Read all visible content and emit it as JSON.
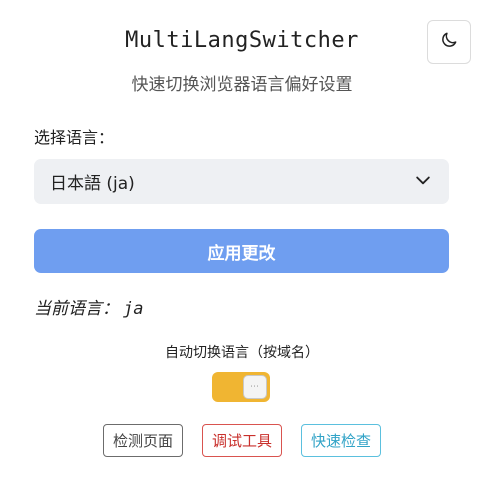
{
  "header": {
    "title": "MultiLangSwitcher",
    "subtitle": "快速切换浏览器语言偏好设置",
    "theme_toggle_icon": "moon-icon"
  },
  "language": {
    "label": "选择语言：",
    "selected": "日本語 (ja)",
    "dropdown_icon": "chevron-down-icon"
  },
  "apply": {
    "label": "应用更改",
    "color": "#6f9ef0"
  },
  "current": {
    "prefix": "当前语言：",
    "code": "ja"
  },
  "auto_switch": {
    "label": "自动切换语言（按域名）",
    "enabled": true,
    "color": "#f0b532"
  },
  "tools": {
    "detect_label": "检测页面",
    "debug_label": "调试工具",
    "quick_label": "快速检查"
  }
}
